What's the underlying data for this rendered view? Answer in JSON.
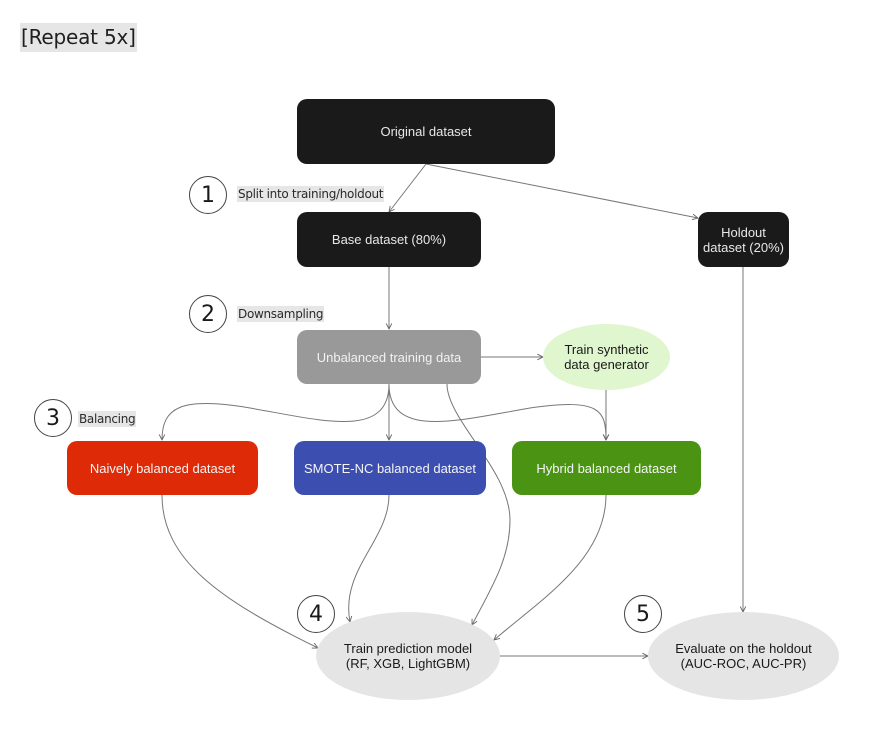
{
  "repeat_label": "[Repeat 5x]",
  "nodes": {
    "original": "Original dataset",
    "base": "Base dataset (80%)",
    "holdout_line1": "Holdout",
    "holdout_line2": "dataset (20%)",
    "unbalanced": "Unbalanced training data",
    "synthetic_line1": "Train synthetic",
    "synthetic_line2": "data generator",
    "naive": "Naively balanced dataset",
    "smote": "SMOTE-NC balanced dataset",
    "hybrid": "Hybrid balanced dataset",
    "train_line1": "Train prediction model",
    "train_line2": "(RF, XGB, LightGBM)",
    "evaluate_line1": "Evaluate on the holdout",
    "evaluate_line2": "(AUC-ROC, AUC-PR)"
  },
  "steps": [
    {
      "number": "1",
      "label": "Split into training/holdout"
    },
    {
      "number": "2",
      "label": "Downsampling"
    },
    {
      "number": "3",
      "label": "Balancing"
    },
    {
      "number": "4",
      "label": ""
    },
    {
      "number": "5",
      "label": ""
    }
  ],
  "colors": {
    "dark_node": "#1a1a1a",
    "unbalanced_node": "#999999",
    "naive_node": "#df2a08",
    "smote_node": "#3c4fb0",
    "hybrid_node": "#4a9313",
    "synthetic_node": "#dff6cf",
    "process_node": "#e5e5e5"
  },
  "edges": [
    {
      "from": "original",
      "to": "base"
    },
    {
      "from": "original",
      "to": "holdout"
    },
    {
      "from": "base",
      "to": "unbalanced"
    },
    {
      "from": "unbalanced",
      "to": "synthetic"
    },
    {
      "from": "unbalanced",
      "to": "naive"
    },
    {
      "from": "unbalanced",
      "to": "smote"
    },
    {
      "from": "unbalanced",
      "to": "hybrid"
    },
    {
      "from": "synthetic",
      "to": "hybrid"
    },
    {
      "from": "unbalanced",
      "to": "train"
    },
    {
      "from": "naive",
      "to": "train"
    },
    {
      "from": "smote",
      "to": "train"
    },
    {
      "from": "hybrid",
      "to": "train"
    },
    {
      "from": "train",
      "to": "evaluate"
    },
    {
      "from": "holdout",
      "to": "evaluate"
    }
  ]
}
